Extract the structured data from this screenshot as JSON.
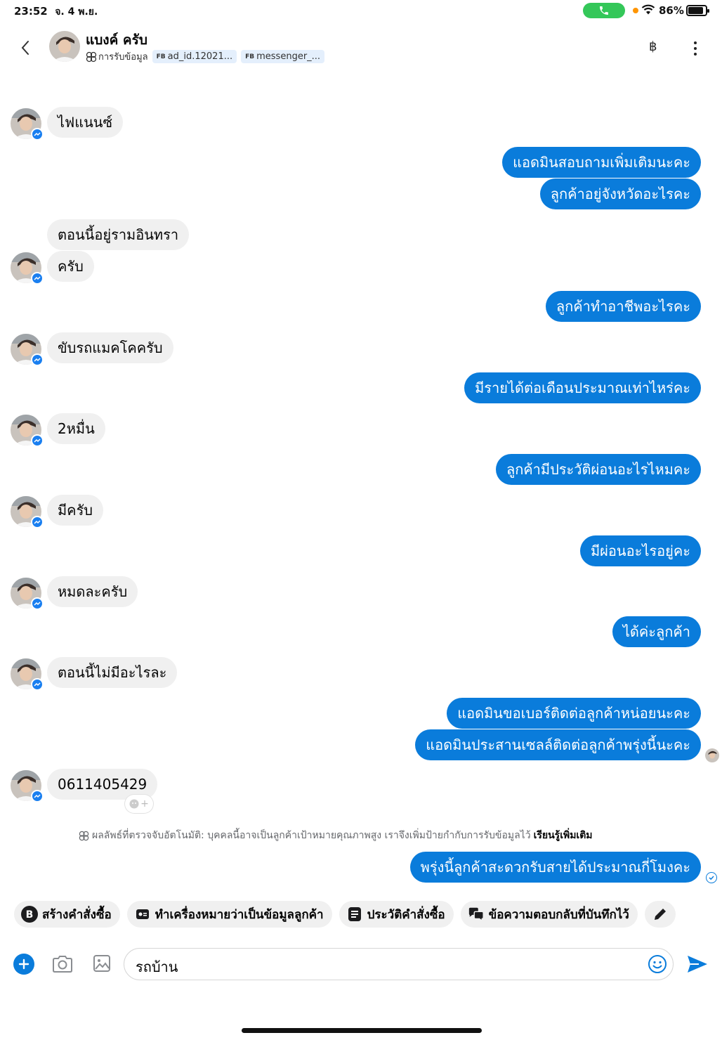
{
  "status_bar": {
    "time": "23:52",
    "date": "จ. 4 พ.ย.",
    "battery": "86%",
    "battery_level": 0.86
  },
  "header": {
    "contact_name": "แบงค์ ครับ",
    "lead_label": "การรับข้อมูล",
    "tags": [
      {
        "prefix": "FB",
        "label": "ad_id.12021..."
      },
      {
        "prefix": "FB",
        "label": "messenger_..."
      }
    ],
    "currency_symbol": "฿"
  },
  "messages": [
    {
      "dir": "in",
      "text": "ไฟแนนซ์"
    },
    {
      "dir": "out",
      "text": "แอดมินสอบถามเพิ่มเติมนะคะ"
    },
    {
      "dir": "out",
      "text": "ลูกค้าอยู่จังหวัดอะไรคะ"
    },
    {
      "dir": "in",
      "text": "ตอนนี้อยู่รามอินทรา"
    },
    {
      "dir": "in",
      "text": "ครับ"
    },
    {
      "dir": "out",
      "text": "ลูกค้าทำอาชีพอะไรคะ"
    },
    {
      "dir": "in",
      "text": "ขับรถแมคโคครับ"
    },
    {
      "dir": "out",
      "text": "มีรายได้ต่อเดือนประมาณเท่าไหร่คะ"
    },
    {
      "dir": "in",
      "text": "2หมื่น"
    },
    {
      "dir": "out",
      "text": "ลูกค้ามีประวัติผ่อนอะไรไหมคะ"
    },
    {
      "dir": "in",
      "text": "มีครับ"
    },
    {
      "dir": "out",
      "text": "มีผ่อนอะไรอยู่คะ"
    },
    {
      "dir": "in",
      "text": "หมดละครับ"
    },
    {
      "dir": "out",
      "text": "ได้ค่ะลูกค้า"
    },
    {
      "dir": "in",
      "text": "ตอนนี้ไม่มีอะไรละ"
    },
    {
      "dir": "out",
      "text": "แอดมินขอเบอร์ติดต่อลูกค้าหน่อยนะคะ"
    },
    {
      "dir": "out",
      "text": "แอดมินประสานเซลล์ติดต่อลูกค้าพรุ่งนี้นะคะ"
    },
    {
      "dir": "in",
      "text": "0611405429"
    },
    {
      "dir": "out",
      "text": "พรุ่งนี้ลูกค้าสะดวกรับสายได้ประมาณกี่โมงคะ"
    }
  ],
  "notice": {
    "text": "ผลลัพธ์ที่ตรวจจับอัตโนมัติ: บุคคลนี้อาจเป็นลูกค้าเป้าหมายคุณภาพสูง เราจึงเพิ่มป้ายกำกับการรับข้อมูลไว้",
    "link": "เรียนรู้เพิ่มเติม"
  },
  "actions": [
    {
      "icon": "bitcoin-icon",
      "label": "สร้างคำสั่งซื้อ"
    },
    {
      "icon": "id-card-icon",
      "label": "ทำเครื่องหมายว่าเป็นข้อมูลลูกค้า"
    },
    {
      "icon": "document-icon",
      "label": "ประวัติคำสั่งซื้อ"
    },
    {
      "icon": "chat-bubbles-icon",
      "label": "ข้อความตอบกลับที่บันทึกไว้"
    }
  ],
  "composer": {
    "value": "รถบ้าน"
  },
  "colors": {
    "outgoing_bubble": "#0a7cdb",
    "incoming_bubble": "#f0f0f0",
    "accent": "#0a7cdb"
  }
}
